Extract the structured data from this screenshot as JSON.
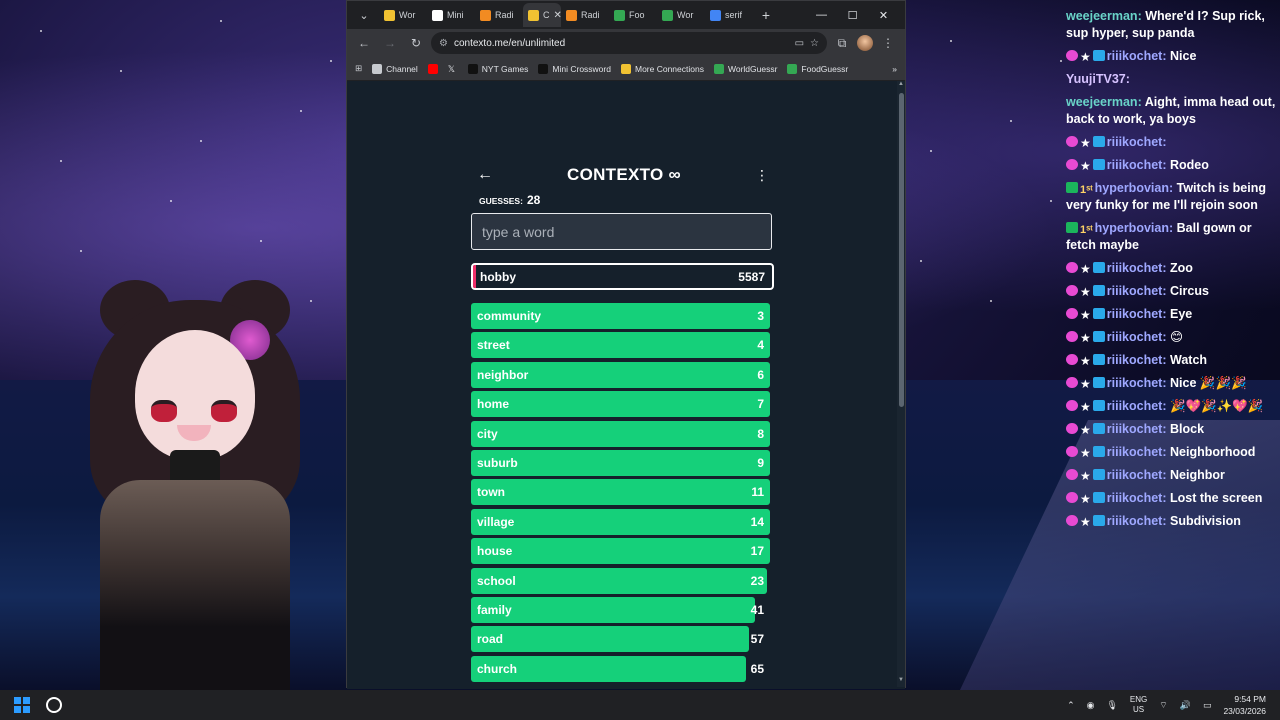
{
  "browser": {
    "tabs": [
      {
        "label": "Wor",
        "icon": "sheets-icon",
        "color": "#f1c232"
      },
      {
        "label": "Mini",
        "icon": "nyt-icon",
        "color": "#ffffff"
      },
      {
        "label": "Radi",
        "icon": "radi-icon",
        "color": "#f28b22"
      },
      {
        "label": "C",
        "icon": "contexto-icon",
        "color": "#f1c232"
      },
      {
        "label": "Radi",
        "icon": "radi-icon",
        "color": "#f28b22"
      },
      {
        "label": "Foo",
        "icon": "globe-icon",
        "color": "#34a853"
      },
      {
        "label": "Wor",
        "icon": "globe-icon",
        "color": "#34a853"
      },
      {
        "label": "serif",
        "icon": "google-icon",
        "color": "#4285f4"
      }
    ],
    "url": "contexto.me/en/unlimited",
    "bookmarks": [
      {
        "label": "Channel",
        "icon": "folder-icon"
      },
      {
        "label": "",
        "icon": "youtube-icon"
      },
      {
        "label": "",
        "icon": "x-icon"
      },
      {
        "label": "NYT Games",
        "icon": "nyt-icon"
      },
      {
        "label": "Mini Crossword",
        "icon": "nyt-icon"
      },
      {
        "label": "More Connections",
        "icon": "grid-icon"
      },
      {
        "label": "WorldGuessr",
        "icon": "globe-icon"
      },
      {
        "label": "FoodGuessr",
        "icon": "globe-icon"
      }
    ]
  },
  "game": {
    "title": "CONTEXTO ∞",
    "guesses_label": "GUESSES:",
    "guesses_count": "28",
    "input_placeholder": "type a word",
    "latest": {
      "word": "hobby",
      "rank": "5587"
    },
    "accent_green": "#15d07a",
    "accent_red": "#ef2f6a",
    "rows": [
      {
        "word": "community",
        "rank": "3",
        "fill": 1.0
      },
      {
        "word": "street",
        "rank": "4",
        "fill": 1.0
      },
      {
        "word": "neighbor",
        "rank": "6",
        "fill": 1.0
      },
      {
        "word": "home",
        "rank": "7",
        "fill": 1.0
      },
      {
        "word": "city",
        "rank": "8",
        "fill": 1.0
      },
      {
        "word": "suburb",
        "rank": "9",
        "fill": 1.0
      },
      {
        "word": "town",
        "rank": "11",
        "fill": 1.0
      },
      {
        "word": "village",
        "rank": "14",
        "fill": 1.0
      },
      {
        "word": "house",
        "rank": "17",
        "fill": 1.0
      },
      {
        "word": "school",
        "rank": "23",
        "fill": 0.99
      },
      {
        "word": "family",
        "rank": "41",
        "fill": 0.95
      },
      {
        "word": "road",
        "rank": "57",
        "fill": 0.93
      },
      {
        "word": "church",
        "rank": "65",
        "fill": 0.92
      }
    ]
  },
  "chat": [
    {
      "user": "weejeerman:",
      "text": "Where'd I? Sup rick, sup hyper, sup panda",
      "badges": [],
      "style": "teal"
    },
    {
      "user": "riiikochet:",
      "text": "Nice",
      "badges": [
        "heart",
        "star",
        "mon"
      ],
      "style": ""
    },
    {
      "user": "YuujiTV37:",
      "text": "",
      "badges": [],
      "style": "gold"
    },
    {
      "user": "weejeerman:",
      "text": "Aight, imma head out, back to work, ya boys",
      "badges": [],
      "style": "teal"
    },
    {
      "user": "riiikochet:",
      "text": "",
      "badges": [
        "heart",
        "star",
        "mon"
      ],
      "style": ""
    },
    {
      "user": "riiikochet:",
      "text": "Rodeo",
      "badges": [
        "heart",
        "star",
        "mon"
      ],
      "style": ""
    },
    {
      "user": "hyperbovian:",
      "text": "Twitch is being very funky for me I'll rejoin soon",
      "badges": [
        "check",
        "one"
      ],
      "style": ""
    },
    {
      "user": "hyperbovian:",
      "text": "Ball gown or fetch maybe",
      "badges": [
        "check",
        "one"
      ],
      "style": ""
    },
    {
      "user": "riiikochet:",
      "text": "Zoo",
      "badges": [
        "heart",
        "star",
        "mon"
      ],
      "style": ""
    },
    {
      "user": "riiikochet:",
      "text": "Circus",
      "badges": [
        "heart",
        "star",
        "mon"
      ],
      "style": ""
    },
    {
      "user": "riiikochet:",
      "text": "Eye",
      "badges": [
        "heart",
        "star",
        "mon"
      ],
      "style": ""
    },
    {
      "user": "riiikochet:",
      "text": "😊",
      "badges": [
        "heart",
        "star",
        "mon"
      ],
      "style": ""
    },
    {
      "user": "riiikochet:",
      "text": "Watch",
      "badges": [
        "heart",
        "star",
        "mon"
      ],
      "style": ""
    },
    {
      "user": "riiikochet:",
      "text": "Nice 🎉🎉🎉",
      "badges": [
        "heart",
        "star",
        "mon"
      ],
      "style": ""
    },
    {
      "user": "riiikochet:",
      "text": "🎉💖🎉✨💖🎉",
      "badges": [
        "heart",
        "star",
        "mon"
      ],
      "style": ""
    },
    {
      "user": "riiikochet:",
      "text": "Block",
      "badges": [
        "heart",
        "star",
        "mon"
      ],
      "style": ""
    },
    {
      "user": "riiikochet:",
      "text": "Neighborhood",
      "badges": [
        "heart",
        "star",
        "mon"
      ],
      "style": ""
    },
    {
      "user": "riiikochet:",
      "text": "Neighbor",
      "badges": [
        "heart",
        "star",
        "mon"
      ],
      "style": ""
    },
    {
      "user": "riiikochet:",
      "text": "Lost the screen",
      "badges": [
        "heart",
        "star",
        "mon"
      ],
      "style": ""
    },
    {
      "user": "riiikochet:",
      "text": "Subdivision",
      "badges": [
        "heart",
        "star",
        "mon"
      ],
      "style": ""
    }
  ],
  "taskbar": {
    "lang_top": "ENG",
    "lang_bottom": "US",
    "time": "9:54 PM",
    "date": "23/03/2026"
  }
}
